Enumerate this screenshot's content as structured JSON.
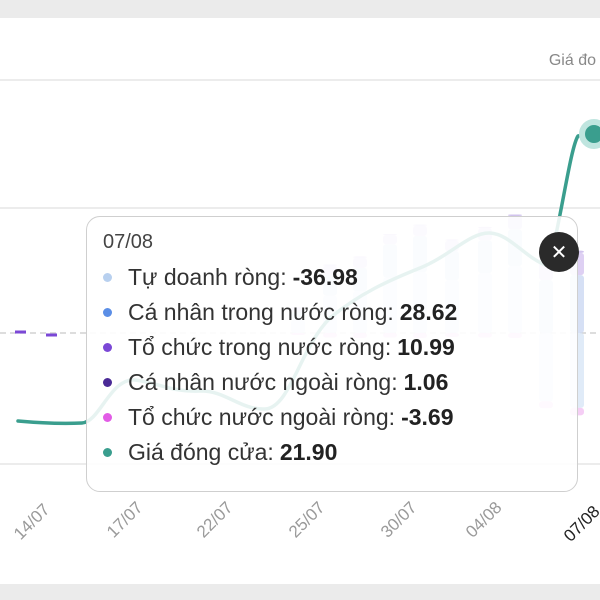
{
  "right_axis_label": "Giá đo",
  "left_edge_glyph": ")",
  "colors": {
    "tu_doanh": "#b8d0ef",
    "ca_nhan_trong_nuoc": "#5b8ee6",
    "to_chuc_trong_nuoc": "#7b48d6",
    "ca_nhan_nuoc_ngoai": "#4a2a96",
    "to_chuc_nuoc_ngoai": "#e25ce6",
    "gia_dong_cua": "#3a9e8e"
  },
  "tooltip": {
    "date": "07/08",
    "rows": [
      {
        "label": "Tự doanh ròng:",
        "value": "-36.98",
        "color": "#b8d0ef"
      },
      {
        "label": "Cá nhân trong nước ròng:",
        "value": "28.62",
        "color": "#5b8ee6"
      },
      {
        "label": "Tổ chức trong nước ròng:",
        "value": "10.99",
        "color": "#7b48d6"
      },
      {
        "label": "Cá nhân nước ngoài ròng:",
        "value": "1.06",
        "color": "#4a2a96"
      },
      {
        "label": "Tổ chức nước ngoài ròng:",
        "value": "-3.69",
        "color": "#e25ce6"
      },
      {
        "label": "Giá đóng cửa:",
        "value": "21.90",
        "color": "#3a9e8e"
      }
    ],
    "close_icon": "close-icon"
  },
  "chart_data": {
    "type": "bar",
    "x": [
      "14/07",
      "17/07",
      "22/07",
      "25/07",
      "30/07",
      "04/08",
      "07/08"
    ],
    "series": [
      {
        "name": "Tự doanh ròng",
        "values": [
          -1,
          -2,
          10,
          25,
          30,
          40,
          -36.98
        ]
      },
      {
        "name": "Cá nhân trong nước ròng",
        "values": [
          1,
          2,
          6,
          14,
          18,
          22,
          28.62
        ]
      },
      {
        "name": "Tổ chức trong nước ròng",
        "values": [
          0.5,
          0.8,
          3,
          6,
          5,
          8,
          10.99
        ]
      },
      {
        "name": "Cá nhân nước ngoài ròng",
        "values": [
          0.3,
          0.2,
          0.5,
          0.8,
          0.6,
          0.9,
          1.06
        ]
      },
      {
        "name": "Tổ chức nước ngoài ròng",
        "values": [
          -0.5,
          -0.4,
          -1.5,
          -3,
          -2.5,
          -3,
          -3.69
        ]
      },
      {
        "name": "Giá đóng cửa",
        "values": [
          19.6,
          19.7,
          19.8,
          20.3,
          20.4,
          20.8,
          21.9
        ]
      }
    ]
  }
}
